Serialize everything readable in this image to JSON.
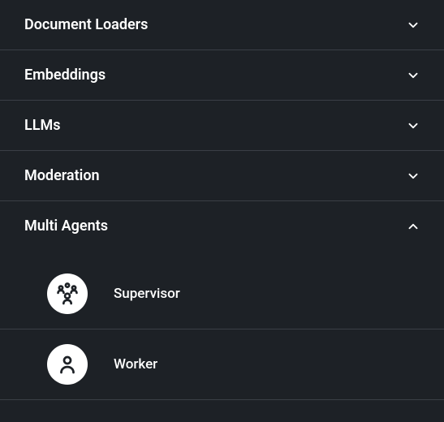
{
  "categories": [
    {
      "id": "document-loaders",
      "label": "Document Loaders",
      "expanded": false
    },
    {
      "id": "embeddings",
      "label": "Embeddings",
      "expanded": false
    },
    {
      "id": "llms",
      "label": "LLMs",
      "expanded": false
    },
    {
      "id": "moderation",
      "label": "Moderation",
      "expanded": false
    },
    {
      "id": "multi-agents",
      "label": "Multi Agents",
      "expanded": true,
      "children": [
        {
          "id": "supervisor",
          "label": "Supervisor",
          "icon": "supervisor-icon"
        },
        {
          "id": "worker",
          "label": "Worker",
          "icon": "worker-icon"
        }
      ]
    }
  ]
}
